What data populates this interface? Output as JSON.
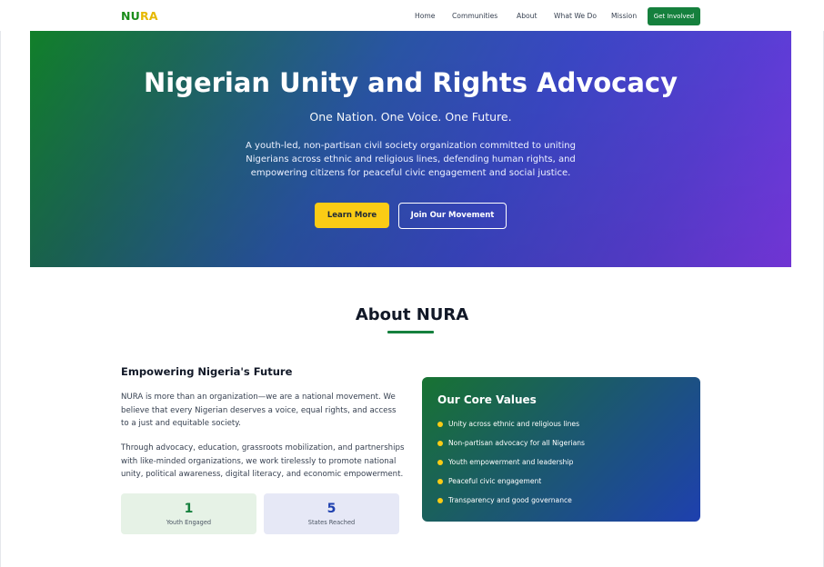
{
  "header": {
    "logo": {
      "part1": "NU",
      "part2": "RA"
    },
    "nav": [
      "Home",
      "Communities",
      "About",
      "What We Do",
      "Mission"
    ],
    "cta": "Get Involved"
  },
  "hero": {
    "title": "Nigerian Unity and Rights Advocacy",
    "subtitle": "One Nation. One Voice. One Future.",
    "description": "A youth-led, non-partisan civil society organization committed to uniting Nigerians across ethnic and religious lines, defending human rights, and empowering citizens for peaceful civic engagement and social justice.",
    "primary_button": "Learn More",
    "secondary_button": "Join Our Movement"
  },
  "about": {
    "title": "About NURA",
    "subheading": "Empowering Nigeria's Future",
    "paragraph1": "NURA is more than an organization—we are a national movement. We believe that every Nigerian deserves a voice, equal rights, and access to a just and equitable society.",
    "paragraph2": "Through advocacy, education, grassroots mobilization, and partnerships with like-minded organizations, we work tirelessly to promote national unity, political awareness, digital literacy, and economic empowerment.",
    "stats": [
      {
        "value": "1",
        "label": "Youth Engaged"
      },
      {
        "value": "5",
        "label": "States Reached"
      }
    ],
    "core_values": {
      "title": "Our Core Values",
      "items": [
        "Unity across ethnic and religious lines",
        "Non-partisan advocacy for all Nigerians",
        "Youth empowerment and leadership",
        "Peaceful civic engagement",
        "Transparency and good governance"
      ]
    }
  },
  "colors": {
    "brand_green": "#15803d",
    "accent_yellow": "#facc15",
    "brand_blue": "#1e40af",
    "brand_purple": "#7d3aeb"
  }
}
